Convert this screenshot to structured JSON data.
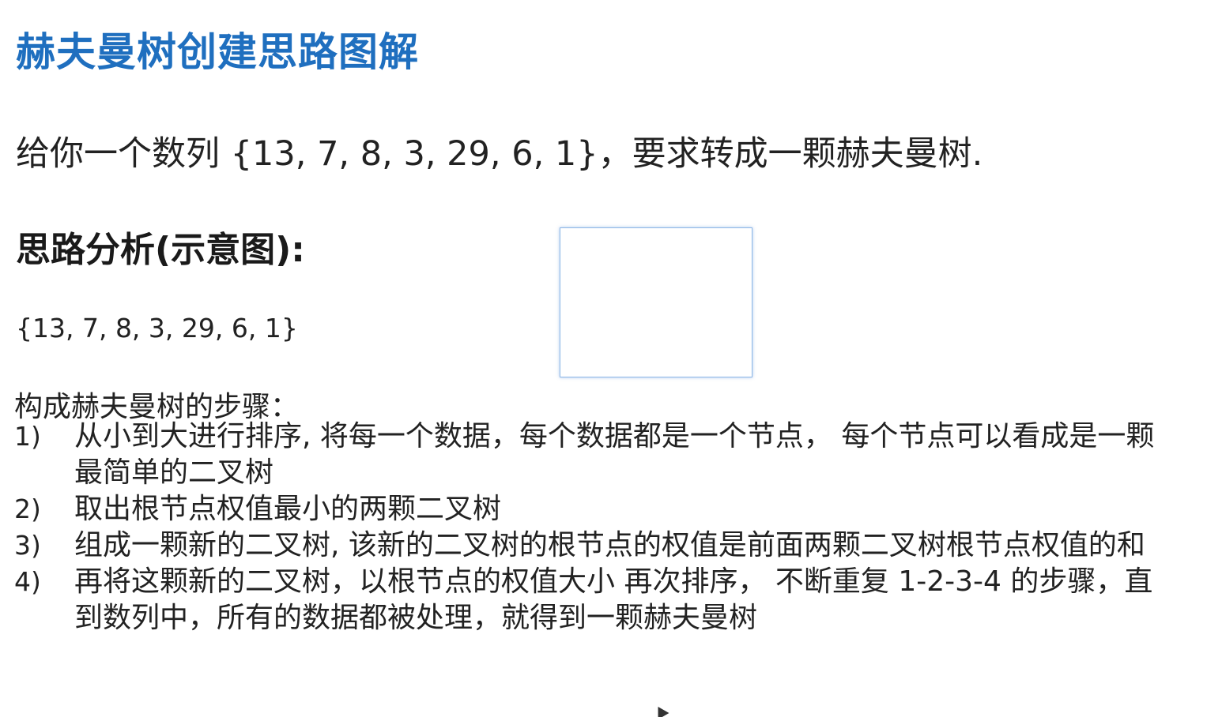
{
  "title": "赫夫曼树创建思路图解",
  "problem": "给你一个数列 {13, 7, 8, 3, 29, 6, 1}，要求转成一颗赫夫曼树.",
  "analysis_heading": "思路分析(示意图):",
  "sequence": "{13, 7, 8, 3, 29, 6, 1}",
  "steps_heading": "构成赫夫曼树的步骤：",
  "steps": [
    {
      "num": "1)",
      "text": "从小到大进行排序, 将每一个数据，每个数据都是一个节点， 每个节点可以看成是一颗最简单的二叉树"
    },
    {
      "num": "2)",
      "text": "取出根节点权值最小的两颗二叉树"
    },
    {
      "num": "3)",
      "text": "组成一颗新的二叉树, 该新的二叉树的根节点的权值是前面两颗二叉树根节点权值的和"
    },
    {
      "num": "4)",
      "text": "再将这颗新的二叉树，以根节点的权值大小 再次排序， 不断重复 1-2-3-4 的步骤，直到数列中，所有的数据都被处理，就得到一颗赫夫曼树"
    }
  ],
  "colors": {
    "title": "#1f6fbf",
    "box_border": "#8cb6e6"
  },
  "icons": {
    "cursor": "mouse-pointer-icon"
  }
}
